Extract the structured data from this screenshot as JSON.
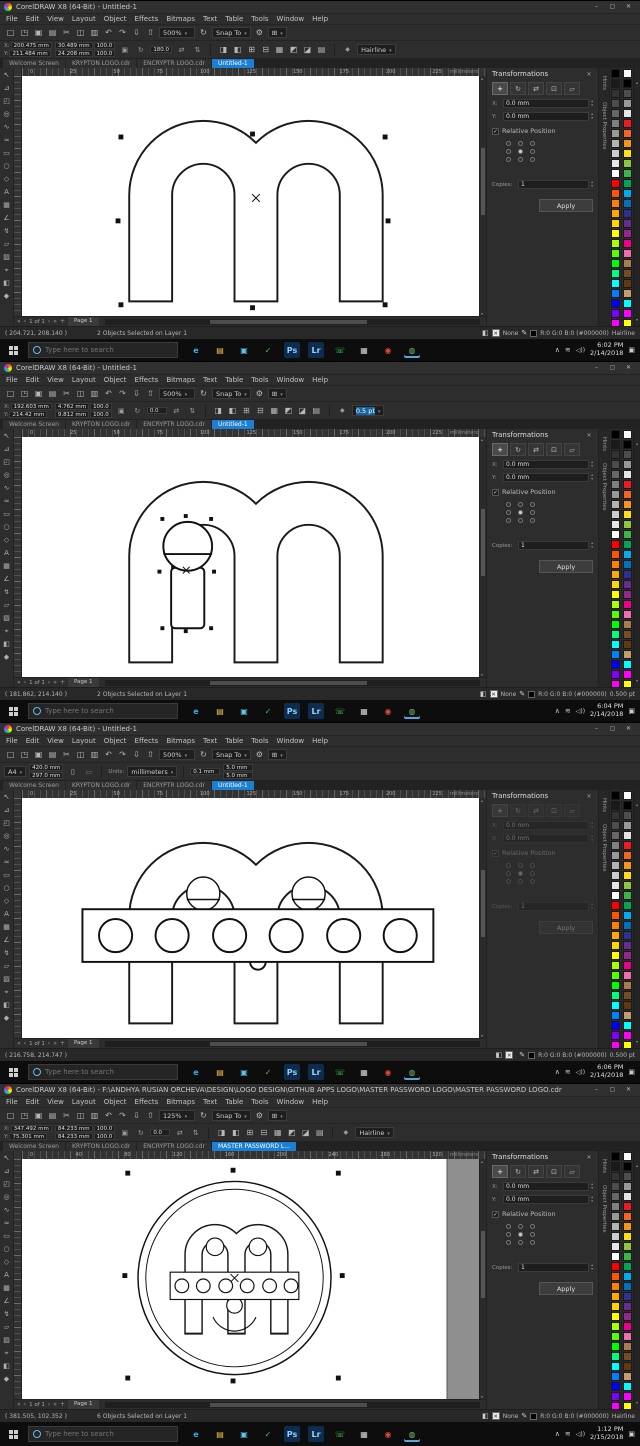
{
  "shared": {
    "menu": [
      "File",
      "Edit",
      "View",
      "Layout",
      "Object",
      "Effects",
      "Bitmaps",
      "Text",
      "Table",
      "Tools",
      "Window",
      "Help"
    ],
    "window_buttons": {
      "min": "–",
      "max": "▢",
      "close": "✕"
    },
    "labels": {
      "x": "X:",
      "y": "Y:",
      "units": "Units:"
    },
    "snap_label": "Snap To",
    "units": "millimeters",
    "std_icons": [
      {
        "name": "new-document-icon",
        "glyph": "□"
      },
      {
        "name": "open-icon",
        "glyph": "◳"
      },
      {
        "name": "save-icon",
        "glyph": "▣"
      },
      {
        "name": "print-icon",
        "glyph": "▤"
      },
      {
        "name": "cut-icon",
        "glyph": "✂"
      },
      {
        "name": "copy-icon",
        "glyph": "◫"
      },
      {
        "name": "paste-icon",
        "glyph": "▥"
      },
      {
        "name": "undo-icon",
        "glyph": "↶"
      },
      {
        "name": "redo-icon",
        "glyph": "↷"
      },
      {
        "name": "import-icon",
        "glyph": "⇩"
      },
      {
        "name": "export-icon",
        "glyph": "⇧"
      }
    ],
    "prop_icons": [
      {
        "name": "to-front-icon",
        "glyph": "◨"
      },
      {
        "name": "to-back-icon",
        "glyph": "◧"
      },
      {
        "name": "group-icon",
        "glyph": "⊞"
      },
      {
        "name": "ungroup-icon",
        "glyph": "⊟"
      },
      {
        "name": "combine-icon",
        "glyph": "▦"
      },
      {
        "name": "weld-icon",
        "glyph": "◩"
      },
      {
        "name": "trim-icon",
        "glyph": "◪"
      },
      {
        "name": "wrap-text-icon",
        "glyph": "▤"
      }
    ],
    "toolbox": [
      {
        "name": "pick-tool-icon",
        "glyph": "↖"
      },
      {
        "name": "shape-tool-icon",
        "glyph": "⊿"
      },
      {
        "name": "crop-tool-icon",
        "glyph": "◰"
      },
      {
        "name": "zoom-tool-icon",
        "glyph": "◎"
      },
      {
        "name": "freehand-tool-icon",
        "glyph": "∿"
      },
      {
        "name": "artistic-media-tool-icon",
        "glyph": "≈"
      },
      {
        "name": "rectangle-tool-icon",
        "glyph": "▭"
      },
      {
        "name": "ellipse-tool-icon",
        "glyph": "○"
      },
      {
        "name": "polygon-tool-icon",
        "glyph": "◇"
      },
      {
        "name": "text-tool-icon",
        "glyph": "A"
      },
      {
        "name": "table-tool-icon",
        "glyph": "▦"
      },
      {
        "name": "dimension-tool-icon",
        "glyph": "∠"
      },
      {
        "name": "connector-tool-icon",
        "glyph": "↯"
      },
      {
        "name": "drop-shadow-tool-icon",
        "glyph": "▱"
      },
      {
        "name": "transparency-tool-icon",
        "glyph": "▨"
      },
      {
        "name": "eyedropper-tool-icon",
        "glyph": "⌖"
      },
      {
        "name": "interactive-fill-tool-icon",
        "glyph": "◧"
      },
      {
        "name": "outline-pen-tool-icon",
        "glyph": "◆"
      }
    ],
    "docker": {
      "title": "Transformations",
      "tools": [
        {
          "name": "position-transform-icon",
          "glyph": "+",
          "active": true
        },
        {
          "name": "rotate-transform-icon",
          "glyph": "↻"
        },
        {
          "name": "scale-mirror-transform-icon",
          "glyph": "⇄"
        },
        {
          "name": "size-transform-icon",
          "glyph": "⊡"
        },
        {
          "name": "skew-transform-icon",
          "glyph": "▱"
        }
      ],
      "relative": "Relative Position",
      "copies_label": "Copies:",
      "copies": "1",
      "apply": "Apply"
    },
    "side_tabs": [
      "Hints",
      "Object Properties"
    ],
    "pagenav": {
      "count": "1 of 1",
      "page": "Page 1"
    },
    "palette1": [
      "#000000",
      "#1a1a1a",
      "#333333",
      "#4d4d4d",
      "#666666",
      "#808080",
      "#999999",
      "#b3b3b3",
      "#cccccc",
      "#e6e6e6",
      "#ffffff",
      "#ff0000",
      "#ff5500",
      "#ff8000",
      "#ffaa00",
      "#ffd500",
      "#ffff00",
      "#aaff00",
      "#55ff00",
      "#00ff00",
      "#00ff80",
      "#00ffff",
      "#0080ff",
      "#0000ff",
      "#8000ff",
      "#ff00ff"
    ],
    "palette2": [
      "#ffffff",
      "#000000",
      "#4d4d4d",
      "#999999",
      "#e6e6e6",
      "#ed1c24",
      "#f26522",
      "#f7941d",
      "#ffde17",
      "#8dc63f",
      "#39b54a",
      "#00a651",
      "#00aeef",
      "#0072bc",
      "#2e3192",
      "#662d91",
      "#92278f",
      "#ec008c",
      "#f06eaa",
      "#a97c50",
      "#754c24",
      "#603913",
      "#c69c6d",
      "#00ffff",
      "#ff00ff",
      "#ffff00"
    ],
    "taskbar": {
      "search": "Type here to search",
      "icons": [
        {
          "name": "edge-icon",
          "glyph": "e",
          "fg": "#35aee8",
          "bg": "transparent"
        },
        {
          "name": "file-explorer-icon",
          "glyph": "▤",
          "fg": "#f3c74a",
          "bg": "transparent"
        },
        {
          "name": "store-icon",
          "glyph": "▣",
          "fg": "#62c3ea",
          "bg": "transparent"
        },
        {
          "name": "security-icon",
          "glyph": "✓",
          "fg": "#47c14a",
          "bg": "transparent"
        },
        {
          "name": "photoshop-icon",
          "glyph": "Ps",
          "fg": "#8ecdf8",
          "bg": "#0d2c4e"
        },
        {
          "name": "lightroom-icon",
          "glyph": "Lr",
          "fg": "#9fd1f5",
          "bg": "#0d2c4e"
        },
        {
          "name": "whatsapp-icon",
          "glyph": "☏",
          "fg": "#4ade57",
          "bg": "transparent"
        },
        {
          "name": "files-app-icon",
          "glyph": "▦",
          "fg": "#d9d9d9",
          "bg": "transparent"
        },
        {
          "name": "chrome-icon",
          "glyph": "◉",
          "fg": "#e8453c",
          "bg": "transparent"
        },
        {
          "name": "coreldraw-taskbar-icon",
          "glyph": "◍",
          "fg": "#6fc26f",
          "bg": "transparent",
          "active": true
        }
      ]
    }
  },
  "panels": [
    {
      "title": "CorelDRAW X8 (64-Bit) - Untitled-1",
      "zoom": "500%",
      "prop": {
        "is_page": false,
        "x": "200.475 mm",
        "y": "211.484 mm",
        "w": "30.489 mm",
        "h": "24.208 mm",
        "sx": "100.0",
        "sy": "100.0",
        "angle": "180.0",
        "outline": "Hairline",
        "outline_hl": false
      },
      "tabs": [
        {
          "label": "Welcome Screen"
        },
        {
          "label": "KRYPTON LOGO.cdr"
        },
        {
          "label": "ENCRYPTR LOGO.cdr"
        },
        {
          "label": "Untitled-1",
          "active": true
        }
      ],
      "ruler": [
        "0",
        "25",
        "50",
        "75",
        "100",
        "125",
        "150",
        "175",
        "200",
        "225"
      ],
      "docker_x": "0.0 mm",
      "docker_y": "0.0 mm",
      "docker_disabled": false,
      "status": {
        "coords": "( 204.721, 208.140 )",
        "objects": "2 Objects Selected on Layer 1",
        "fill": "None",
        "outline_color": "R:0 G:0 B:0 (#000000)",
        "outline_width": "Hairline"
      },
      "time": "6:02 PM",
      "date": "2/14/2018",
      "drawing": "m1"
    },
    {
      "title": "CorelDRAW X8 (64-Bit) - Untitled-1",
      "zoom": "500%",
      "prop": {
        "is_page": false,
        "x": "192.603 mm",
        "y": "214.42 mm",
        "w": "4.762 mm",
        "h": "9.812 mm",
        "sx": "100.0",
        "sy": "100.0",
        "angle": "0.0",
        "outline": "0.5 pt",
        "outline_hl": true
      },
      "tabs": [
        {
          "label": "Welcome Screen"
        },
        {
          "label": "KRYPTON LOGO.cdr"
        },
        {
          "label": "ENCRYPTR LOGO.cdr"
        },
        {
          "label": "Untitled-1",
          "active": true
        }
      ],
      "ruler": [
        "0",
        "25",
        "50",
        "75",
        "100",
        "125",
        "150",
        "175",
        "200",
        "225"
      ],
      "docker_x": "0.0 mm",
      "docker_y": "0.0 mm",
      "docker_disabled": false,
      "status": {
        "coords": "( 181.862, 214.140 )",
        "objects": "2 Objects Selected on Layer 1",
        "fill": "None",
        "outline_color": "R:0 G:0 B:0 (#000000)",
        "outline_width": "0.500 pt"
      },
      "time": "6:04 PM",
      "date": "2/14/2018",
      "drawing": "m2"
    },
    {
      "title": "CorelDRAW X8 (64-Bit) - Untitled-1",
      "zoom": "500%",
      "prop": {
        "is_page": true,
        "size": "A4",
        "pw": "420.0 mm",
        "ph": "297.0 mm",
        "units": "millimeters",
        "nudge": "0.1 mm",
        "dupx": "5.0 mm",
        "dupy": "5.0 mm"
      },
      "tabs": [
        {
          "label": "Welcome Screen"
        },
        {
          "label": "KRYPTON LOGO.cdr"
        },
        {
          "label": "ENCRYPTR LOGO.cdr"
        },
        {
          "label": "Untitled-1",
          "active": true
        }
      ],
      "ruler": [
        "0",
        "25",
        "50",
        "75",
        "100",
        "125",
        "150",
        "175",
        "200",
        "225"
      ],
      "docker_x": "0.0 mm",
      "docker_y": "0.0 mm",
      "docker_disabled": true,
      "status": {
        "coords": "( 216.758, 214.747 )",
        "objects": "",
        "fill": "",
        "outline_color": "R:0 G:0 B:0 (#000000)",
        "outline_width": "0.500 pt"
      },
      "time": "6:06 PM",
      "date": "2/14/2018",
      "drawing": "m3"
    },
    {
      "title": "CorelDRAW X8 (64-Bit) - F:\\ANDHYA RUSIAN ORCHEVA\\DESIGN\\LOGO DESIGN\\GITHUB APPS LOGO\\MASTER PASSWORD LOGO\\MASTER PASSWORD LOGO.cdr",
      "zoom": "125%",
      "prop": {
        "is_page": false,
        "x": "347.492 mm",
        "y": "75.301 mm",
        "w": "84.233 mm",
        "h": "84.233 mm",
        "sx": "100.0",
        "sy": "100.0",
        "angle": "0.0",
        "outline": "Hairline",
        "outline_hl": false
      },
      "tabs": [
        {
          "label": "Welcome Screen"
        },
        {
          "label": "KRYPTON LOGO.cdr"
        },
        {
          "label": "ENCRYPTR LOGO.cdr"
        },
        {
          "label": "MASTER PASSWORD L...",
          "active": true
        }
      ],
      "ruler": [
        "0",
        "40",
        "80",
        "120",
        "160",
        "200",
        "240",
        "280",
        "320"
      ],
      "docker_x": "0.0 mm",
      "docker_y": "0.0 mm",
      "docker_disabled": false,
      "status": {
        "coords": "( 381.505, 102.352 )",
        "objects": "6 Objects Selected on Layer 1",
        "fill": "None",
        "outline_color": "R:0 G:0 B:0 (#000000)",
        "outline_width": "Hairline"
      },
      "time": "1:12 PM",
      "date": "2/15/2018",
      "drawing": "logo"
    }
  ]
}
